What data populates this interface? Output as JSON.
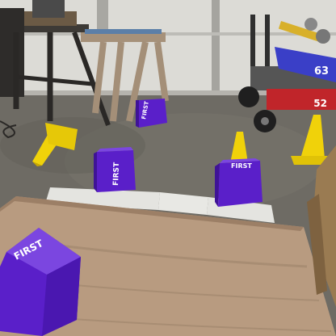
{
  "scene": {
    "description_kind": "photo",
    "colors": {
      "wall": "#d9d8d3",
      "floor": "#6d6a63",
      "floor_light": "#8a877f",
      "board": "#b89b80",
      "board_dark": "#9c7f66",
      "cube_purple": "#5a1fc9",
      "cube_purple_dark": "#3f1396",
      "cube_purple_light": "#7b46e0",
      "cone_yellow": "#f0d20a",
      "cone_yellow_dark": "#c9a800",
      "robot_blue": "#3a3fc7",
      "robot_red": "#c0252a",
      "tile_white": "#e4e4e0"
    },
    "cube_labels": {
      "cube_1": "FIRST",
      "cube_2": "FIRST",
      "cube_3": "FIRST",
      "cube_4": "FIRST"
    },
    "robot_number": "63",
    "robot_number_2": "52"
  }
}
